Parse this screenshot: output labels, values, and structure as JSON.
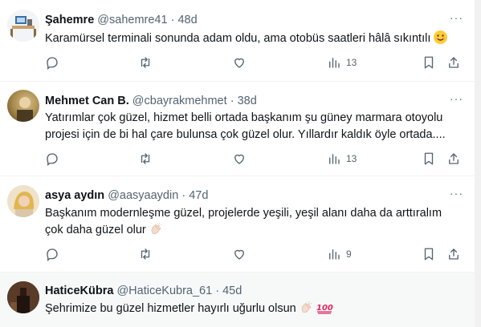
{
  "tweets": [
    {
      "name": "Şahemre",
      "handle": "@sahemre41",
      "time": "48d",
      "text": "Karamürsel terminali sonunda adam oldu, ama otobüs saatleri hâlâ sıkıntılı",
      "emoji": "smiling-face",
      "views": "13"
    },
    {
      "name": "Mehmet Can B.",
      "handle": "@cbayrakmehmet",
      "time": "38d",
      "text_line1": "Yatırımlar çok güzel, hizmet belli ortada başkanım şu güney marmara otoyolu",
      "text_line2": "projesi için de bi hal çare bulunsa çok güzel olur. Yıllardır kaldık öyle ortada....",
      "views": "13"
    },
    {
      "name": "asya aydın",
      "handle": "@aasyaaydin",
      "time": "47d",
      "text_line1": "Başkanım modernleşme güzel, projelerde yeşili, yeşil alanı daha da arttıralım",
      "text_line2": "çok daha güzel olur",
      "emoji": "clapping-hands",
      "views": "9"
    },
    {
      "name": "HaticeKübra",
      "handle": "@HaticeKubra_61",
      "time": "45d",
      "text": "Şehrimize bu güzel hizmetler hayırlı uğurlu olsun",
      "emoji": [
        "clapping-hands",
        "hundred-points"
      ]
    }
  ],
  "separator": "·",
  "more_label": "···",
  "colors": {
    "text": "#0f1419",
    "muted": "#536471",
    "divider": "#eff3f4"
  }
}
